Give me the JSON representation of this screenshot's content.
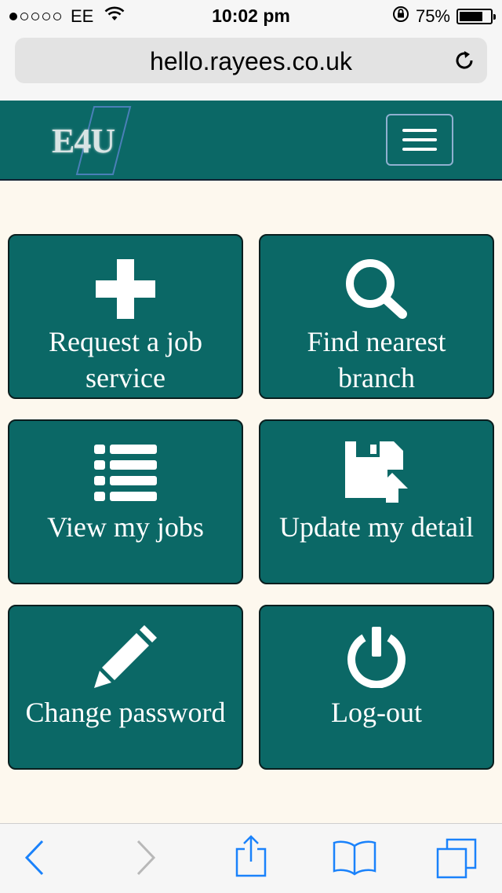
{
  "status_bar": {
    "signal_dots_filled": 1,
    "signal_dots_total": 5,
    "carrier": "EE",
    "time": "10:02 pm",
    "battery_percent": "75%",
    "battery_level": 0.75
  },
  "browser": {
    "url": "hello.rayees.co.uk",
    "reload_icon": "reload-icon"
  },
  "navbar": {
    "logo_text": "E4U",
    "menu_icon": "hamburger-icon"
  },
  "tiles": [
    {
      "label": "Request a job\nservice",
      "icon": "plus-icon"
    },
    {
      "label": "Find nearest\nbranch",
      "icon": "search-icon"
    },
    {
      "label": "View my jobs",
      "icon": "list-icon"
    },
    {
      "label": "Update my detail",
      "icon": "save-upload-icon"
    },
    {
      "label": "Change password",
      "icon": "pencil-icon"
    },
    {
      "label": "Log-out",
      "icon": "power-icon"
    }
  ],
  "toolbar": {
    "back_icon": "back-icon",
    "forward_icon": "forward-icon",
    "share_icon": "share-icon",
    "bookmarks_icon": "bookmarks-icon",
    "tabs_icon": "tabs-icon"
  },
  "colors": {
    "brand_teal": "#0b6866",
    "page_background": "#fdf8ee",
    "ios_blue": "#1a82fb"
  }
}
